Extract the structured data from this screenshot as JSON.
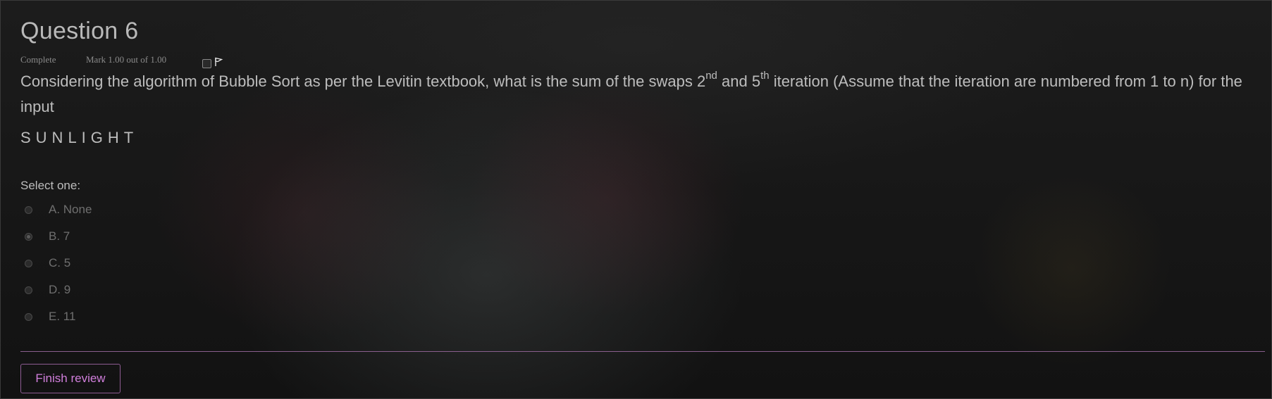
{
  "question": {
    "title": "Question 6",
    "state": "Complete",
    "mark": "Mark 1.00 out of 1.00",
    "flag_icon": "flag-icon",
    "text_part1": "Considering the algorithm of Bubble Sort as per the Levitin textbook, what is the sum of the swaps 2",
    "sup1": "nd",
    "text_part2": " and 5",
    "sup2": "th",
    "text_part3": " iteration (Assume that the iteration are numbered from 1 to n) for the input",
    "input_word": "SUNLIGHT",
    "select_label": "Select one:",
    "options": [
      {
        "label": "A. None",
        "checked": false
      },
      {
        "label": "B. 7",
        "checked": true
      },
      {
        "label": "C. 5",
        "checked": false
      },
      {
        "label": "D. 9",
        "checked": false
      },
      {
        "label": "E. 11",
        "checked": false
      }
    ]
  },
  "footer": {
    "finish_label": "Finish review"
  },
  "colors": {
    "accent": "#d17fdc",
    "divider": "#8a5f8e",
    "text": "#bdbdbd"
  }
}
